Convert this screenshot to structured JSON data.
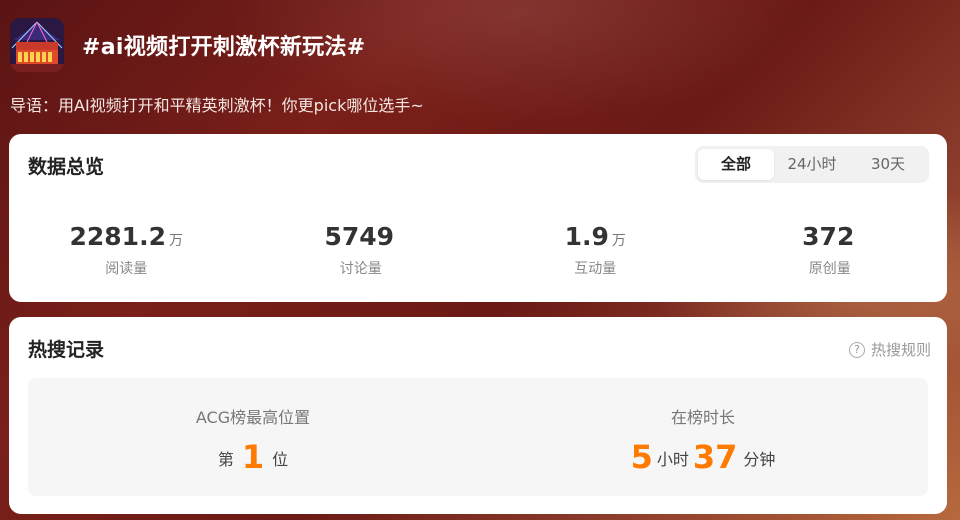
{
  "header": {
    "title": "#ai视频打开刺激杯新玩法#",
    "intro": "导语：用AI视频打开和平精英刺激杯！你更pick哪位选手~"
  },
  "overview": {
    "title": "数据总览",
    "tabs": [
      "全部",
      "24小时",
      "30天"
    ],
    "active_tab": "全部",
    "stats": [
      {
        "value": "2281.2",
        "unit": "万",
        "label": "阅读量"
      },
      {
        "value": "5749",
        "unit": "",
        "label": "讨论量"
      },
      {
        "value": "1.9",
        "unit": "万",
        "label": "互动量"
      },
      {
        "value": "372",
        "unit": "",
        "label": "原创量"
      }
    ]
  },
  "hot": {
    "title": "热搜记录",
    "rules_label": "热搜规则",
    "rules_icon": "?",
    "rank": {
      "label": "ACG榜最高位置",
      "prefix": "第",
      "value": "1",
      "suffix": "位"
    },
    "duration": {
      "label": "在榜时长",
      "hours": "5",
      "hours_unit": "小时",
      "minutes": "37",
      "minutes_unit": "分钟"
    }
  },
  "colors": {
    "accent": "#ff7a00",
    "background": "#6b1a15"
  }
}
